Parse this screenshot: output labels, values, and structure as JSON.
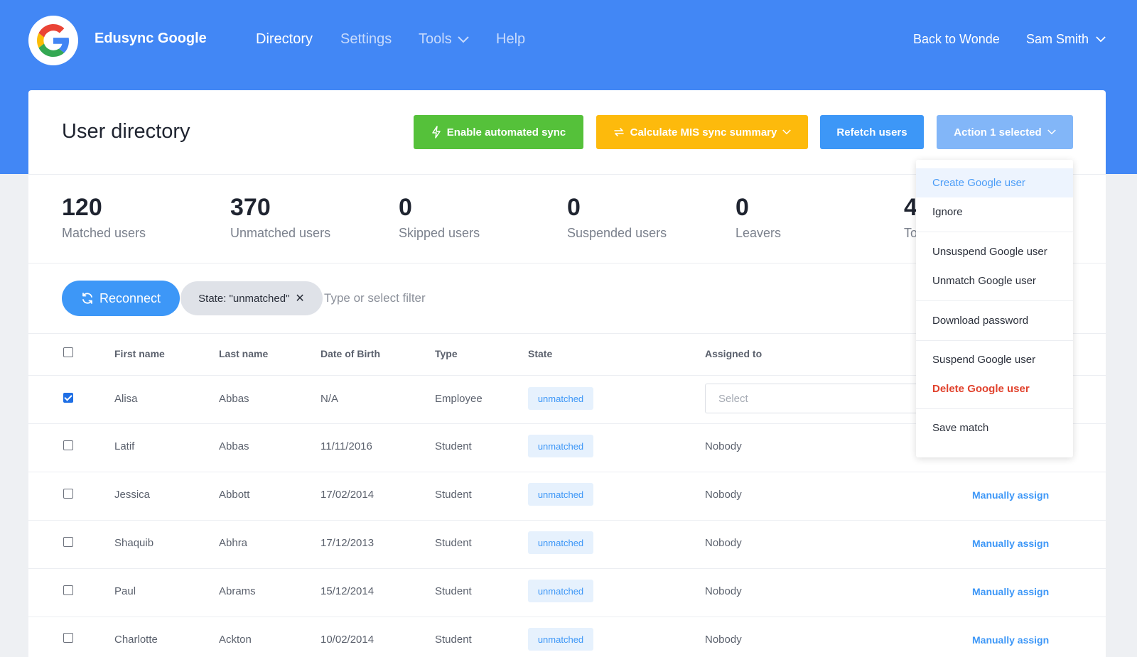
{
  "app": {
    "brand": "Edusync Google",
    "nav": [
      {
        "label": "Directory",
        "active": true
      },
      {
        "label": "Settings",
        "active": false
      },
      {
        "label": "Tools",
        "active": false,
        "has_dropdown": true
      },
      {
        "label": "Help",
        "active": false
      }
    ],
    "back_link": "Back to Wonde",
    "user_name": "Sam Smith"
  },
  "toolbar": {
    "title": "User directory",
    "enable_sync": "Enable automated sync",
    "calc_summary": "Calculate MIS sync summary",
    "refetch": "Refetch users",
    "action": "Action 1 selected"
  },
  "stats": [
    {
      "value": "120",
      "label": "Matched users"
    },
    {
      "value": "370",
      "label": "Unmatched users"
    },
    {
      "value": "0",
      "label": "Skipped users"
    },
    {
      "value": "0",
      "label": "Suspended users"
    },
    {
      "value": "0",
      "label": "Leavers"
    },
    {
      "value": "4",
      "label": "To"
    }
  ],
  "filters": {
    "reconnect": "Reconnect",
    "chip": "State: \"unmatched\"",
    "placeholder": "Type or select filter"
  },
  "table": {
    "headers": [
      "First name",
      "Last name",
      "Date of Birth",
      "Type",
      "State",
      "Assigned to"
    ],
    "rows": [
      {
        "first": "Alisa",
        "last": "Abbas",
        "dob": "N/A",
        "type": "Employee",
        "state": "unmatched",
        "assigned": "",
        "select_placeholder": "Select",
        "checked": true,
        "action": ""
      },
      {
        "first": "Latif",
        "last": "Abbas",
        "dob": "11/11/2016",
        "type": "Student",
        "state": "unmatched",
        "assigned": "Nobody",
        "checked": false,
        "action": ""
      },
      {
        "first": "Jessica",
        "last": "Abbott",
        "dob": "17/02/2014",
        "type": "Student",
        "state": "unmatched",
        "assigned": "Nobody",
        "checked": false,
        "action": "Manually assign"
      },
      {
        "first": "Shaquib",
        "last": "Abhra",
        "dob": "17/12/2013",
        "type": "Student",
        "state": "unmatched",
        "assigned": "Nobody",
        "checked": false,
        "action": "Manually assign"
      },
      {
        "first": "Paul",
        "last": "Abrams",
        "dob": "15/12/2014",
        "type": "Student",
        "state": "unmatched",
        "assigned": "Nobody",
        "checked": false,
        "action": "Manually assign"
      },
      {
        "first": "Charlotte",
        "last": "Ackton",
        "dob": "10/02/2014",
        "type": "Student",
        "state": "unmatched",
        "assigned": "Nobody",
        "checked": false,
        "action": "Manually assign"
      }
    ]
  },
  "action_menu": {
    "items": [
      {
        "label": "Create Google user",
        "highlight": true
      },
      {
        "label": "Ignore"
      },
      {
        "label": "Unsuspend Google user"
      },
      {
        "label": "Unmatch Google user"
      },
      {
        "label": "Download password"
      },
      {
        "label": "Suspend Google user"
      },
      {
        "label": "Delete Google user",
        "danger": true
      },
      {
        "label": "Save match"
      }
    ]
  },
  "colors": {
    "header_bg": "#4287f5",
    "green": "#55c13a",
    "yellow": "#fdba0c",
    "blue": "#3d97f7",
    "danger": "#e1422d"
  }
}
